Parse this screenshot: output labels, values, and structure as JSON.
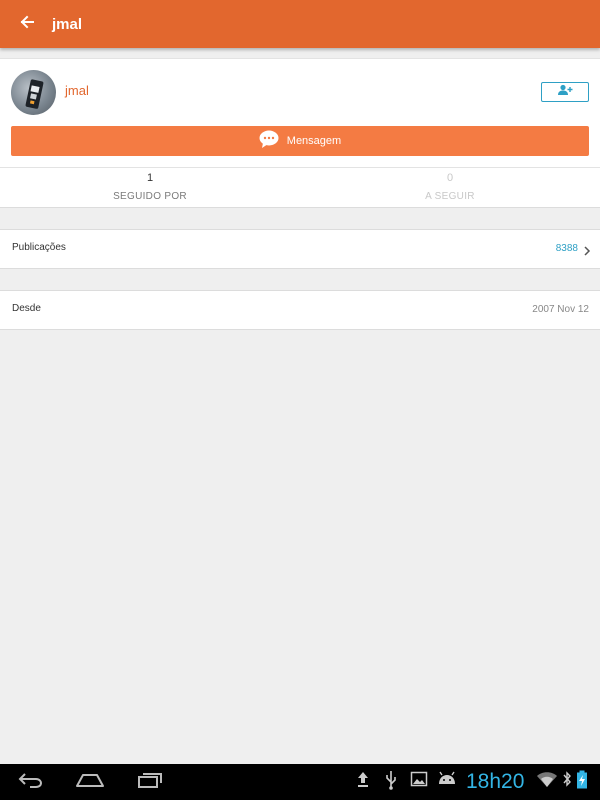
{
  "app_bar": {
    "title": "jmal",
    "background": "#e2672e",
    "back_icon": "arrow-left-icon"
  },
  "profile": {
    "username": "jmal",
    "avatar_icon": "user-avatar-photo",
    "follow_icon": "add-person-icon",
    "message_button": {
      "label": "Mensagem",
      "icon": "chat-bubble-icon",
      "background": "#f47b43"
    }
  },
  "stats": [
    {
      "value": "1",
      "label": "SEGUIDO POR",
      "active": true
    },
    {
      "value": "0",
      "label": "A SEGUIR",
      "active": false
    }
  ],
  "details": {
    "publications": {
      "label": "Publicações",
      "value": "8388"
    },
    "since": {
      "label": "Desde",
      "value": "2007 Nov 12"
    }
  },
  "system_bar": {
    "clock": "18h20",
    "accent": "#33b5e5",
    "nav_icons": [
      "back-icon",
      "home-icon",
      "recent-apps-icon"
    ],
    "status_icons": [
      "upload-icon",
      "usb-icon",
      "gallery-icon",
      "android-icon",
      "wifi-icon",
      "bluetooth-icon",
      "battery-charging-icon"
    ]
  }
}
